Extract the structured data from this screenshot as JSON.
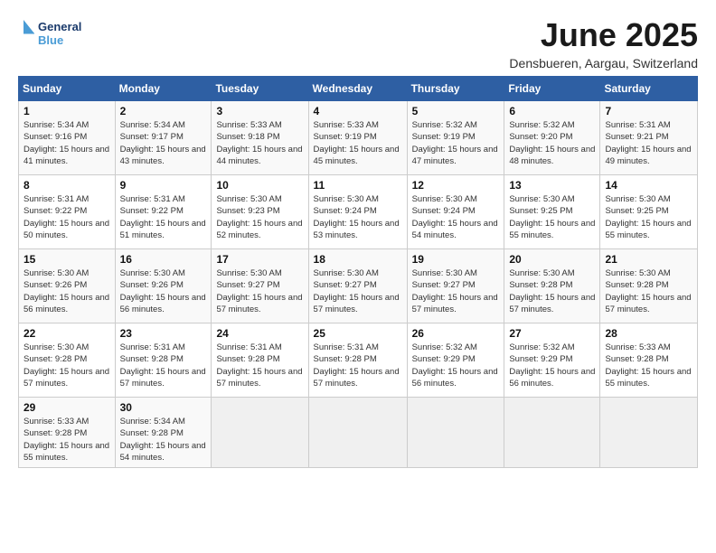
{
  "logo": {
    "general": "General",
    "blue": "Blue"
  },
  "header": {
    "month": "June 2025",
    "location": "Densbueren, Aargau, Switzerland"
  },
  "weekdays": [
    "Sunday",
    "Monday",
    "Tuesday",
    "Wednesday",
    "Thursday",
    "Friday",
    "Saturday"
  ],
  "weeks": [
    [
      {
        "day": "1",
        "sunrise": "Sunrise: 5:34 AM",
        "sunset": "Sunset: 9:16 PM",
        "daylight": "Daylight: 15 hours and 41 minutes."
      },
      {
        "day": "2",
        "sunrise": "Sunrise: 5:34 AM",
        "sunset": "Sunset: 9:17 PM",
        "daylight": "Daylight: 15 hours and 43 minutes."
      },
      {
        "day": "3",
        "sunrise": "Sunrise: 5:33 AM",
        "sunset": "Sunset: 9:18 PM",
        "daylight": "Daylight: 15 hours and 44 minutes."
      },
      {
        "day": "4",
        "sunrise": "Sunrise: 5:33 AM",
        "sunset": "Sunset: 9:19 PM",
        "daylight": "Daylight: 15 hours and 45 minutes."
      },
      {
        "day": "5",
        "sunrise": "Sunrise: 5:32 AM",
        "sunset": "Sunset: 9:19 PM",
        "daylight": "Daylight: 15 hours and 47 minutes."
      },
      {
        "day": "6",
        "sunrise": "Sunrise: 5:32 AM",
        "sunset": "Sunset: 9:20 PM",
        "daylight": "Daylight: 15 hours and 48 minutes."
      },
      {
        "day": "7",
        "sunrise": "Sunrise: 5:31 AM",
        "sunset": "Sunset: 9:21 PM",
        "daylight": "Daylight: 15 hours and 49 minutes."
      }
    ],
    [
      {
        "day": "8",
        "sunrise": "Sunrise: 5:31 AM",
        "sunset": "Sunset: 9:22 PM",
        "daylight": "Daylight: 15 hours and 50 minutes."
      },
      {
        "day": "9",
        "sunrise": "Sunrise: 5:31 AM",
        "sunset": "Sunset: 9:22 PM",
        "daylight": "Daylight: 15 hours and 51 minutes."
      },
      {
        "day": "10",
        "sunrise": "Sunrise: 5:30 AM",
        "sunset": "Sunset: 9:23 PM",
        "daylight": "Daylight: 15 hours and 52 minutes."
      },
      {
        "day": "11",
        "sunrise": "Sunrise: 5:30 AM",
        "sunset": "Sunset: 9:24 PM",
        "daylight": "Daylight: 15 hours and 53 minutes."
      },
      {
        "day": "12",
        "sunrise": "Sunrise: 5:30 AM",
        "sunset": "Sunset: 9:24 PM",
        "daylight": "Daylight: 15 hours and 54 minutes."
      },
      {
        "day": "13",
        "sunrise": "Sunrise: 5:30 AM",
        "sunset": "Sunset: 9:25 PM",
        "daylight": "Daylight: 15 hours and 55 minutes."
      },
      {
        "day": "14",
        "sunrise": "Sunrise: 5:30 AM",
        "sunset": "Sunset: 9:25 PM",
        "daylight": "Daylight: 15 hours and 55 minutes."
      }
    ],
    [
      {
        "day": "15",
        "sunrise": "Sunrise: 5:30 AM",
        "sunset": "Sunset: 9:26 PM",
        "daylight": "Daylight: 15 hours and 56 minutes."
      },
      {
        "day": "16",
        "sunrise": "Sunrise: 5:30 AM",
        "sunset": "Sunset: 9:26 PM",
        "daylight": "Daylight: 15 hours and 56 minutes."
      },
      {
        "day": "17",
        "sunrise": "Sunrise: 5:30 AM",
        "sunset": "Sunset: 9:27 PM",
        "daylight": "Daylight: 15 hours and 57 minutes."
      },
      {
        "day": "18",
        "sunrise": "Sunrise: 5:30 AM",
        "sunset": "Sunset: 9:27 PM",
        "daylight": "Daylight: 15 hours and 57 minutes."
      },
      {
        "day": "19",
        "sunrise": "Sunrise: 5:30 AM",
        "sunset": "Sunset: 9:27 PM",
        "daylight": "Daylight: 15 hours and 57 minutes."
      },
      {
        "day": "20",
        "sunrise": "Sunrise: 5:30 AM",
        "sunset": "Sunset: 9:28 PM",
        "daylight": "Daylight: 15 hours and 57 minutes."
      },
      {
        "day": "21",
        "sunrise": "Sunrise: 5:30 AM",
        "sunset": "Sunset: 9:28 PM",
        "daylight": "Daylight: 15 hours and 57 minutes."
      }
    ],
    [
      {
        "day": "22",
        "sunrise": "Sunrise: 5:30 AM",
        "sunset": "Sunset: 9:28 PM",
        "daylight": "Daylight: 15 hours and 57 minutes."
      },
      {
        "day": "23",
        "sunrise": "Sunrise: 5:31 AM",
        "sunset": "Sunset: 9:28 PM",
        "daylight": "Daylight: 15 hours and 57 minutes."
      },
      {
        "day": "24",
        "sunrise": "Sunrise: 5:31 AM",
        "sunset": "Sunset: 9:28 PM",
        "daylight": "Daylight: 15 hours and 57 minutes."
      },
      {
        "day": "25",
        "sunrise": "Sunrise: 5:31 AM",
        "sunset": "Sunset: 9:28 PM",
        "daylight": "Daylight: 15 hours and 57 minutes."
      },
      {
        "day": "26",
        "sunrise": "Sunrise: 5:32 AM",
        "sunset": "Sunset: 9:29 PM",
        "daylight": "Daylight: 15 hours and 56 minutes."
      },
      {
        "day": "27",
        "sunrise": "Sunrise: 5:32 AM",
        "sunset": "Sunset: 9:29 PM",
        "daylight": "Daylight: 15 hours and 56 minutes."
      },
      {
        "day": "28",
        "sunrise": "Sunrise: 5:33 AM",
        "sunset": "Sunset: 9:28 PM",
        "daylight": "Daylight: 15 hours and 55 minutes."
      }
    ],
    [
      {
        "day": "29",
        "sunrise": "Sunrise: 5:33 AM",
        "sunset": "Sunset: 9:28 PM",
        "daylight": "Daylight: 15 hours and 55 minutes."
      },
      {
        "day": "30",
        "sunrise": "Sunrise: 5:34 AM",
        "sunset": "Sunset: 9:28 PM",
        "daylight": "Daylight: 15 hours and 54 minutes."
      },
      null,
      null,
      null,
      null,
      null
    ]
  ]
}
